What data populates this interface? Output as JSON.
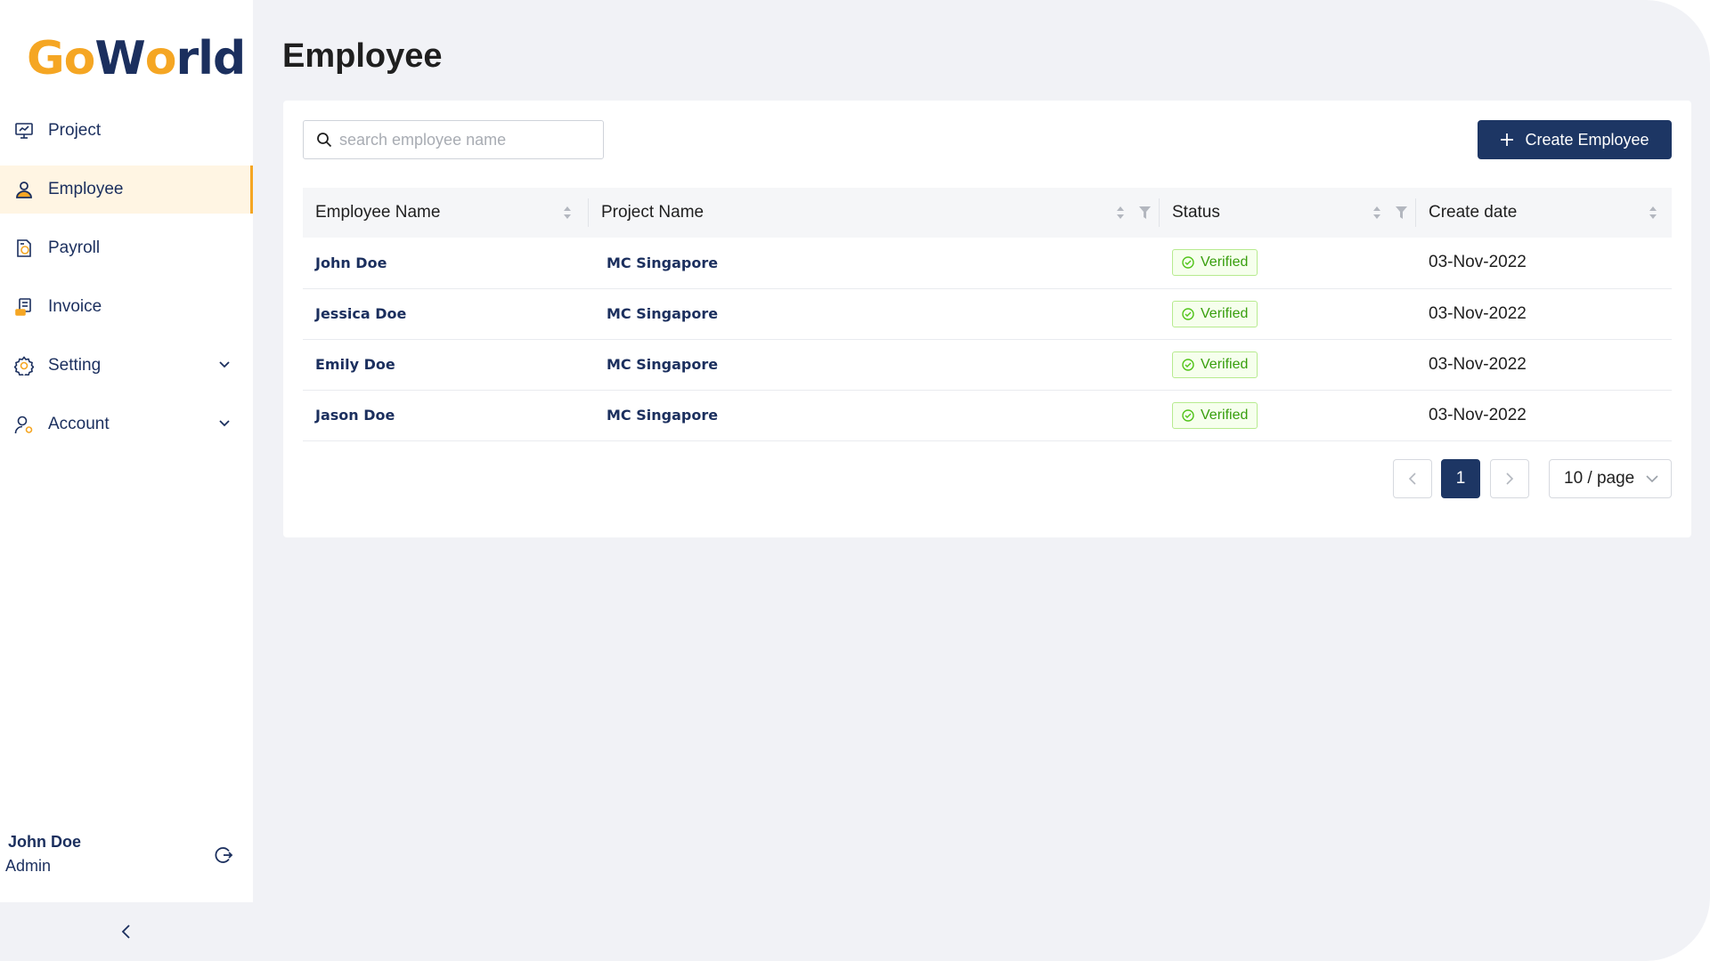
{
  "brand": {
    "logo_part1": "Go",
    "logo_part2": "W",
    "logo_part3": "o",
    "logo_part4": "rld",
    "accent_color": "#f5a623",
    "primary_color": "#1d3664"
  },
  "sidebar": {
    "items": [
      {
        "label": "Project",
        "icon": "presentation-icon"
      },
      {
        "label": "Employee",
        "icon": "person-icon",
        "active": true
      },
      {
        "label": "Payroll",
        "icon": "payroll-document-icon"
      },
      {
        "label": "Invoice",
        "icon": "invoice-icon"
      },
      {
        "label": "Setting",
        "icon": "gear-icon",
        "expandable": true
      },
      {
        "label": "Account",
        "icon": "user-gear-icon",
        "expandable": true
      }
    ],
    "user": {
      "name": "John Doe",
      "role": "Admin"
    }
  },
  "main": {
    "title": "Employee",
    "search": {
      "placeholder": "search employee name",
      "value": ""
    },
    "create_button": "Create Employee",
    "table": {
      "columns": [
        "Employee Name",
        "Project Name",
        "Status",
        "Create date"
      ],
      "rows": [
        {
          "name": "John Doe",
          "project": "MC Singapore",
          "status": "Verified",
          "date": "03-Nov-2022"
        },
        {
          "name": "Jessica Doe",
          "project": "MC Singapore",
          "status": "Verified",
          "date": "03-Nov-2022"
        },
        {
          "name": "Emily Doe",
          "project": "MC Singapore",
          "status": "Verified",
          "date": "03-Nov-2022"
        },
        {
          "name": "Jason Doe",
          "project": "MC Singapore",
          "status": "Verified",
          "date": "03-Nov-2022"
        }
      ]
    },
    "pagination": {
      "current_page": "1",
      "page_size": "10 / page"
    }
  }
}
